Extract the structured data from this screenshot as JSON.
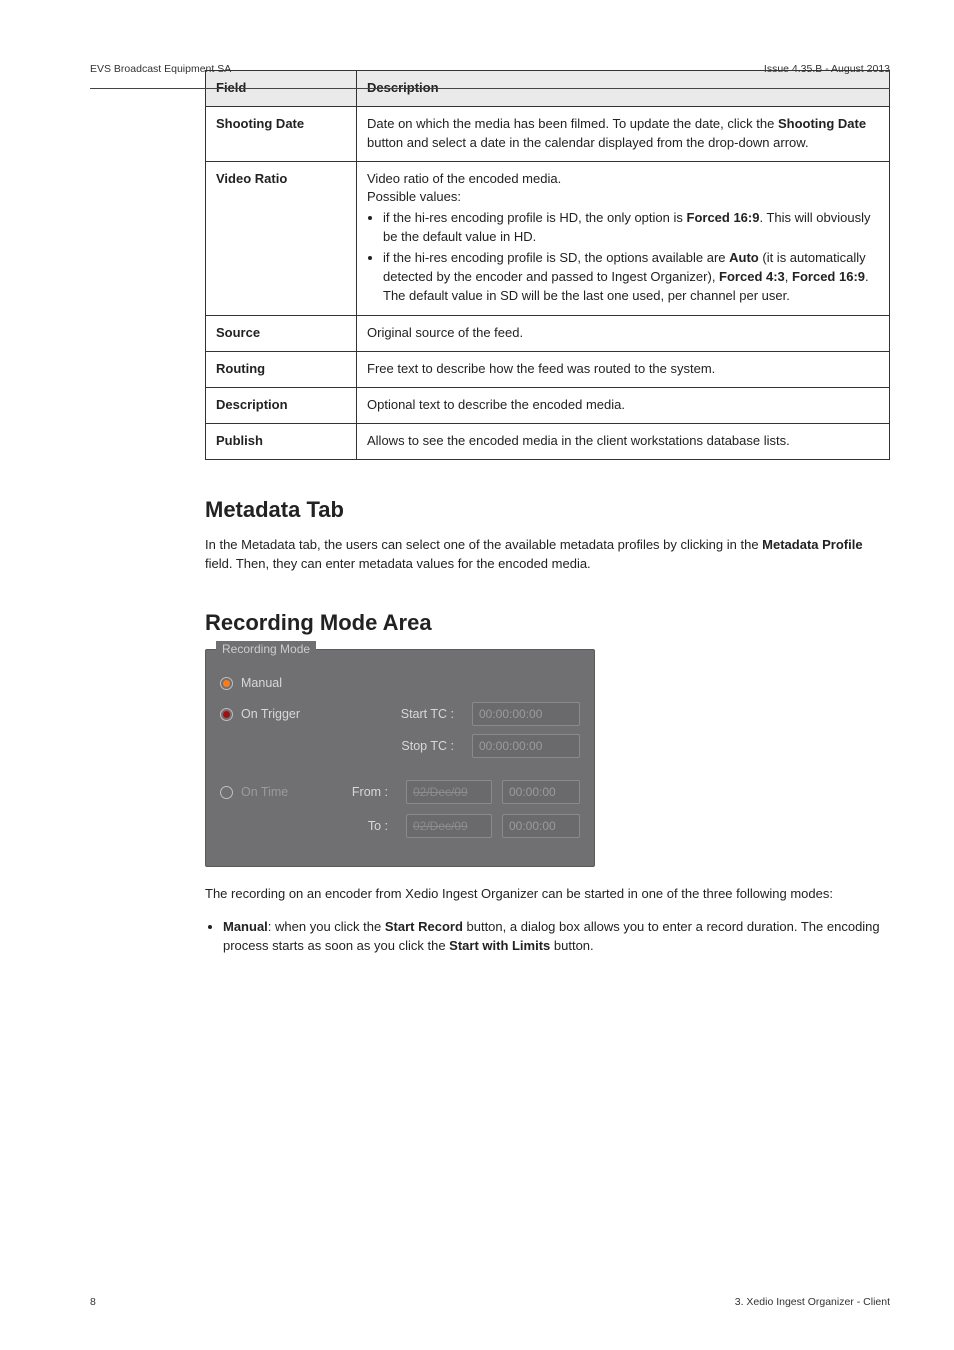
{
  "running_head": {
    "left": "EVS Broadcast Equipment SA",
    "right": "Issue 4.35.B - August 2013"
  },
  "table": {
    "head_field": "Field",
    "head_desc": "Description",
    "rows": [
      {
        "field": "Shooting Date",
        "desc_pre": "Date on which the media has been filmed. To update the date, click the ",
        "desc_bold": "Shooting Date",
        "desc_post": " button and select a date in the calendar displayed from the drop-down arrow."
      },
      {
        "field": "Video Ratio",
        "intro1": "Video ratio of the encoded media.",
        "intro2": "Possible values:",
        "b1_pre": "if the hi-res encoding profile is HD, the only option is ",
        "b1_bold1": "Forced 16:9",
        "b1_mid": ". This will obviously be the default value in HD.",
        "b2_pre": "if the hi-res encoding profile is SD, the options available are ",
        "b2_bold1": "Auto",
        "b2_mid1": " (it is automatically detected by the encoder and passed to Ingest Organizer), ",
        "b2_bold2": "Forced 4:3",
        "b2_mid2": ", ",
        "b2_bold3": "Forced 16:9",
        "b2_mid3": ".",
        "b2_tail": "The default value in SD will be the last one used, per channel per user."
      },
      {
        "field": "Source",
        "desc": "Original source of the feed."
      },
      {
        "field": "Routing",
        "desc": "Free text to describe how the feed was routed to the system."
      },
      {
        "field": "Description",
        "desc": "Optional text to describe the encoded media."
      },
      {
        "field": "Publish",
        "desc": "Allows to see the encoded media in the client workstations database lists."
      }
    ]
  },
  "metadata": {
    "heading": "Metadata Tab",
    "para_pre": "In the Metadata tab, the users can select one of the available metadata profiles by clicking in the ",
    "para_bold": "Metadata Profile",
    "para_post": " field. Then, they can enter metadata values for the encoded media."
  },
  "recording": {
    "heading": "Recording Mode Area",
    "legend": "Recording Mode",
    "opt_manual": "Manual",
    "opt_trigger": "On Trigger",
    "opt_time": "On Time",
    "start_tc_label": "Start TC :",
    "stop_tc_label": "Stop TC :",
    "tc_placeholder": "00:00:00:00",
    "from_label": "From :",
    "to_label": "To :",
    "date_placeholder": "02/Dec/09",
    "tc_small_placeholder": "00:00:00",
    "post_para": "The recording on an encoder from Xedio Ingest Organizer can be started in one of the three following modes:",
    "bullet_pre": "",
    "bullet_bold1": "Manual",
    "bullet_mid1": ": when you click the ",
    "bullet_bold2": "Start Record",
    "bullet_mid2": " button, a dialog box allows you to enter a record duration. The encoding process starts as soon as you click the ",
    "bullet_bold3": "Start with Limits",
    "bullet_mid3": " button."
  },
  "footer": {
    "left": "8",
    "right": "3. Xedio Ingest Organizer - Client"
  }
}
